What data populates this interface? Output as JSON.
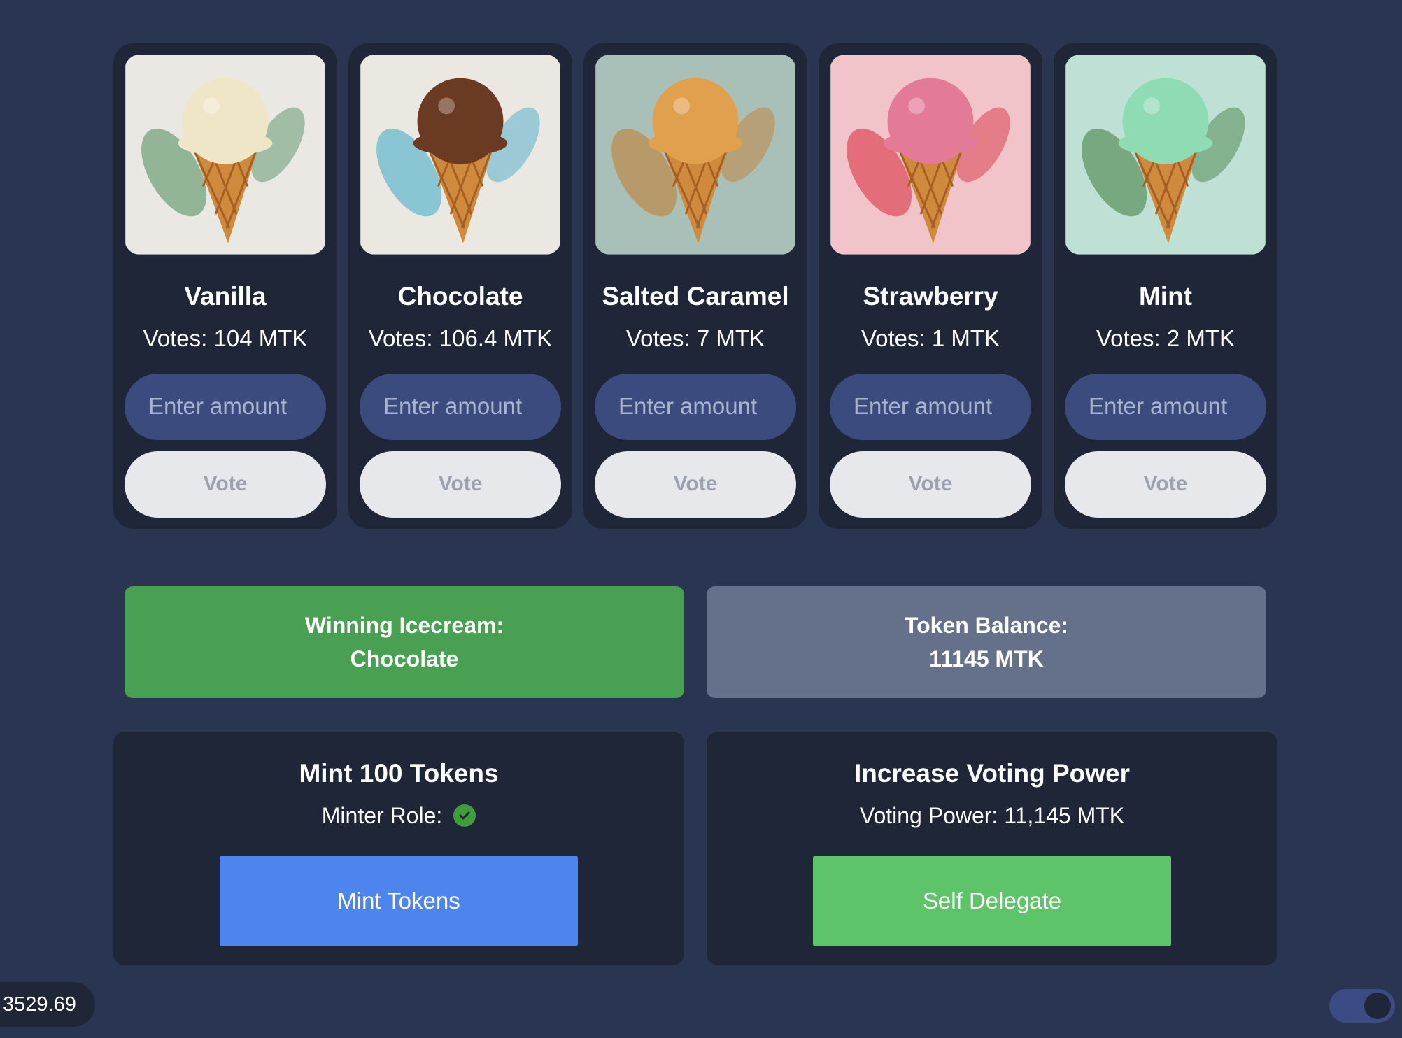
{
  "flavors": [
    {
      "name": "Vanilla",
      "votes": "Votes: 104 MTK",
      "placeholder": "Enter amount",
      "vote_label": "Vote",
      "image_icon": "vanilla-ice-cream-cone-image",
      "bg": "#e9e8e2",
      "scoop": "#efe6c8",
      "accent": "#4a8a5a"
    },
    {
      "name": "Chocolate",
      "votes": "Votes: 106.4 MTK",
      "placeholder": "Enter amount",
      "vote_label": "Vote",
      "image_icon": "chocolate-ice-cream-cone-image",
      "bg": "#ebe8e2",
      "scoop": "#6b3a22",
      "accent": "#3aa7c8"
    },
    {
      "name": "Salted Caramel",
      "votes": "Votes: 7 MTK",
      "placeholder": "Enter amount",
      "vote_label": "Vote",
      "image_icon": "caramel-ice-cream-cone-image",
      "bg": "#a9c0b8",
      "scoop": "#e0a04e",
      "accent": "#c47a2a"
    },
    {
      "name": "Strawberry",
      "votes": "Votes: 1 MTK",
      "placeholder": "Enter amount",
      "vote_label": "Vote",
      "image_icon": "strawberry-ice-cream-cone-image",
      "bg": "#f0c4c8",
      "scoop": "#e27a98",
      "accent": "#d8283a"
    },
    {
      "name": "Mint",
      "votes": "Votes: 2 MTK",
      "placeholder": "Enter amount",
      "vote_label": "Vote",
      "image_icon": "mint-ice-cream-cone-image",
      "bg": "#bfe0d4",
      "scoop": "#8fdcb4",
      "accent": "#3e7a3a"
    }
  ],
  "winning": {
    "label": "Winning Icecream:",
    "value": "Chocolate"
  },
  "balance": {
    "label": "Token Balance:",
    "value": "11145 MTK"
  },
  "mint_panel": {
    "title": "Mint 100 Tokens",
    "role_label": "Minter Role:",
    "role_icon": "check-circle-icon",
    "button": "Mint Tokens"
  },
  "power_panel": {
    "title": "Increase Voting Power",
    "power_label": "Voting Power: 11,145 MTK",
    "button": "Self Delegate"
  },
  "price": "3529.69",
  "colors": {
    "background": "#2a3551",
    "card": "#1e2638",
    "winning": "#4aa052",
    "balance": "#65718a",
    "mint_button": "#4e84ee",
    "delegate_button": "#5dc46a"
  }
}
